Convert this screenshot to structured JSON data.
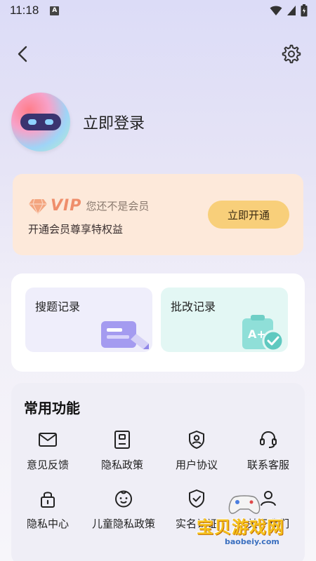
{
  "status_bar": {
    "time": "11:18",
    "notification_icon": "A"
  },
  "header": {
    "back_icon": "chevron-left-icon",
    "settings_icon": "gear-icon"
  },
  "profile": {
    "login_label": "立即登录"
  },
  "vip": {
    "badge": "VIP",
    "status": "您还不是会员",
    "subtitle": "开通会员尊享特权益",
    "button_label": "立即开通",
    "colors": {
      "card_bg": "#fde9da",
      "button_bg": "#f8cf7a",
      "accent": "#ef8e6b"
    }
  },
  "records": [
    {
      "label": "搜题记录",
      "icon": "document-pen-icon"
    },
    {
      "label": "批改记录",
      "icon": "clipboard-check-icon"
    }
  ],
  "functions": {
    "title": "常用功能",
    "items": [
      {
        "label": "意见反馈",
        "icon": "mail-icon"
      },
      {
        "label": "隐私政策",
        "icon": "privacy-doc-icon"
      },
      {
        "label": "用户协议",
        "icon": "shield-user-icon"
      },
      {
        "label": "联系客服",
        "icon": "headset-icon"
      },
      {
        "label": "隐私中心",
        "icon": "lock-icon"
      },
      {
        "label": "儿童隐私政策",
        "icon": "child-face-icon"
      },
      {
        "label": "实名认证",
        "icon": "shield-check-icon"
      },
      {
        "label": "关于我们",
        "icon": "person-icon"
      }
    ]
  },
  "watermark": {
    "text": "宝贝游戏网",
    "url": "baobeiy.com"
  }
}
